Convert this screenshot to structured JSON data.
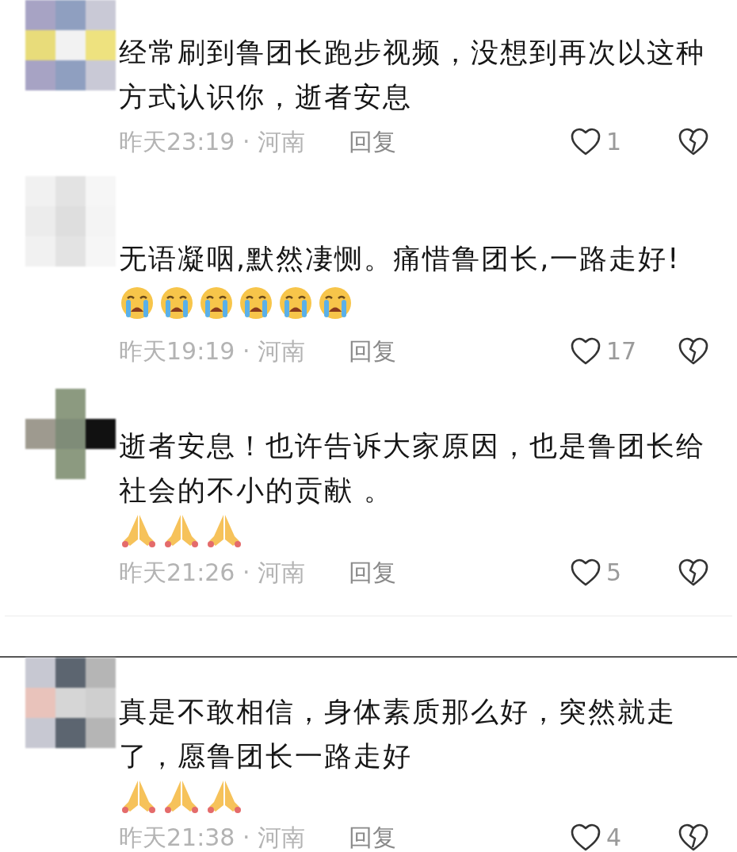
{
  "comments": [
    {
      "text": "经常刷到鲁团长跑步视频，没想到再次以这种方式认识你，逝者安息",
      "meta": "昨天23:19 · 河南",
      "reply": "回复",
      "likes": "1"
    },
    {
      "text": "无语凝咽,默然凄恻。痛惜鲁团长,一路走好!",
      "emojis": [
        {
          "kind": "crying"
        },
        {
          "kind": "crying"
        },
        {
          "kind": "crying"
        },
        {
          "kind": "crying"
        },
        {
          "kind": "crying"
        },
        {
          "kind": "crying"
        }
      ],
      "meta": "昨天19:19 · 河南",
      "reply": "回复",
      "likes": "17"
    },
    {
      "text": "逝者安息！也许告诉大家原因，也是鲁团长给社会的不小的贡献 。",
      "emojis": [
        {
          "kind": "praying"
        },
        {
          "kind": "praying"
        },
        {
          "kind": "praying"
        }
      ],
      "meta": "昨天21:26 · 河南",
      "reply": "回复",
      "likes": "5"
    },
    {
      "text": "真是不敢相信，身体素质那么好，突然就走了，愿鲁团长一路走好",
      "emojis": [
        {
          "kind": "praying"
        },
        {
          "kind": "praying"
        },
        {
          "kind": "praying"
        }
      ],
      "meta": "昨天21:38 · 河南",
      "reply": "回复",
      "likes": "4"
    }
  ]
}
